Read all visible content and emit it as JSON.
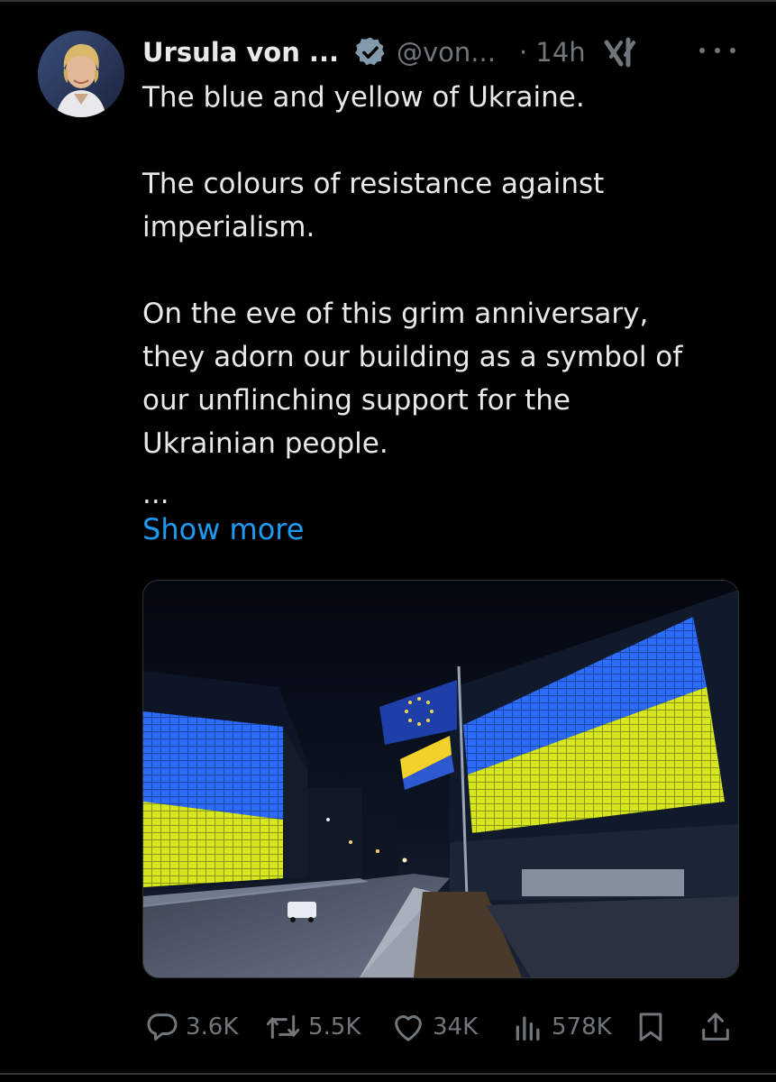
{
  "author": {
    "display_name": "Ursula von ...",
    "handle": "@von...",
    "timestamp": "· 14h",
    "verified": true
  },
  "tweet": {
    "text": "The blue and yellow of Ukraine.\n\nThe colours of resistance against\nimperialism.\n\nOn the eve of this grim anniversary,\nthey adorn our building as a symbol of\nour unflinching support for the\nUkrainian people.",
    "truncation": "...",
    "show_more_label": "Show more"
  },
  "actions": {
    "replies": "3.6K",
    "reposts": "5.5K",
    "likes": "34K",
    "views": "578K"
  },
  "colors": {
    "background": "#000000",
    "text": "#e7e9ea",
    "muted": "#71767b",
    "link": "#1d9bf0",
    "verified_badge": "#829aab",
    "ukraine_blue": "#2c6bff",
    "ukraine_yellow": "#d6e61e"
  },
  "icons": [
    "verified-icon",
    "grok-icon",
    "more-icon",
    "reply-icon",
    "repost-icon",
    "like-icon",
    "views-icon",
    "bookmark-icon",
    "share-icon"
  ]
}
